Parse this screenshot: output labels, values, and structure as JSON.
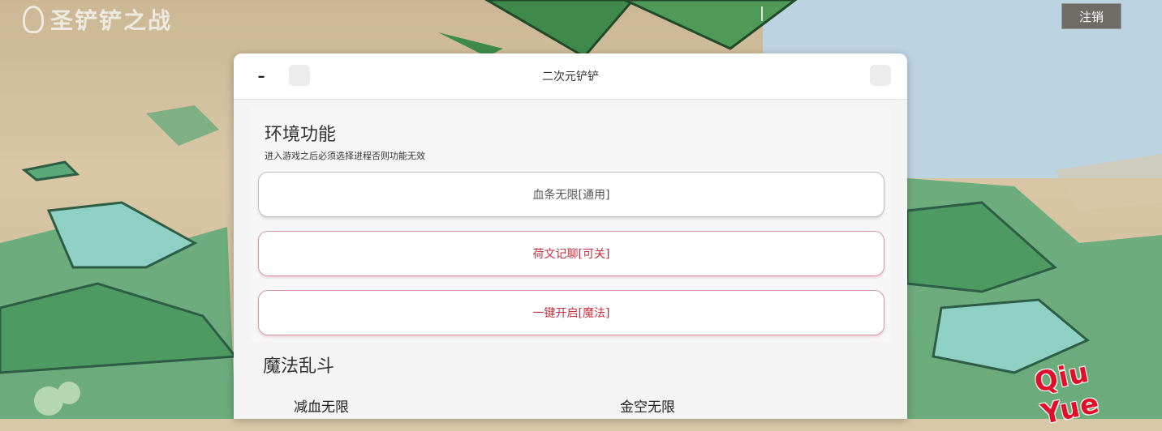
{
  "page": {
    "logo_text": "圣铲铲之战",
    "top_link": "",
    "login_label": "注销",
    "watermark": "Qiu Yue"
  },
  "dialog": {
    "title": "二次元铲铲",
    "min_label": "–",
    "sections": [
      {
        "title": "环境功能",
        "description": "进入游戏之后必须选择进程否则功能无效",
        "buttons": [
          {
            "label": "血条无限[通用]",
            "style": "gray"
          },
          {
            "label": "荷文记聊[可关]",
            "style": "red"
          },
          {
            "label": "一键开启[魔法]",
            "style": "red"
          }
        ]
      },
      {
        "title": "魔法乱斗",
        "options": [
          "减血无限",
          "金空无限"
        ]
      }
    ]
  },
  "colors": {
    "accent_red": "#c4303f",
    "button_border_red": "#d59aa1",
    "button_border_gray": "#bdbdbd"
  }
}
